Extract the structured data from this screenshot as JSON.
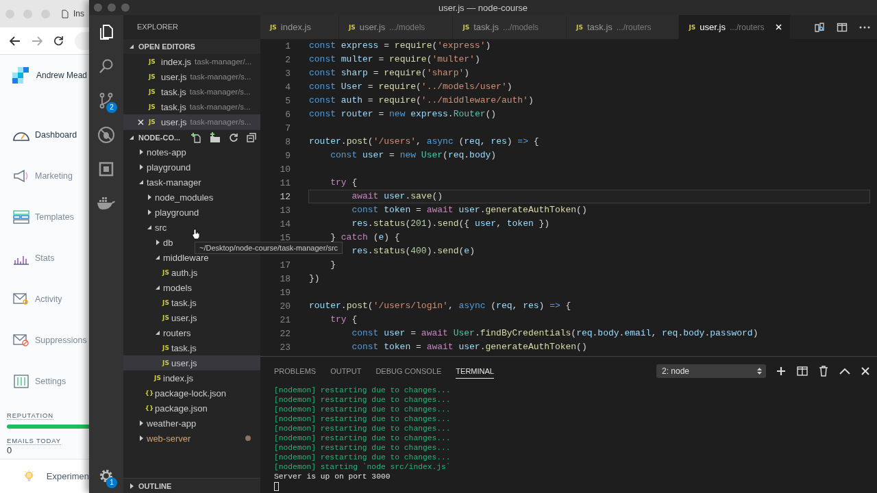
{
  "browser": {
    "tab_title": "Ins",
    "brand": "Andrew Mead",
    "nav": [
      {
        "label": "Dashboard",
        "selected": true
      },
      {
        "label": "Marketing",
        "selected": false
      },
      {
        "label": "Templates",
        "selected": false
      },
      {
        "label": "Stats",
        "selected": false
      },
      {
        "label": "Activity",
        "selected": false
      },
      {
        "label": "Suppressions",
        "selected": false
      },
      {
        "label": "Settings",
        "selected": false
      }
    ],
    "reputation": {
      "label": "REPUTATION",
      "level": 1
    },
    "emails_today": {
      "label": "EMAILS TODAY",
      "value": "0"
    },
    "footer": {
      "label": "Experimen"
    }
  },
  "window": {
    "title": "user.js — node-course"
  },
  "activity_bar": {
    "items": [
      {
        "kind": "files",
        "selected": true
      },
      {
        "kind": "search",
        "selected": false
      },
      {
        "kind": "source-control",
        "selected": false,
        "badge": "2"
      },
      {
        "kind": "debug",
        "selected": false
      },
      {
        "kind": "remote",
        "selected": false
      },
      {
        "kind": "docker",
        "selected": false
      }
    ],
    "settings": {
      "badge": "1"
    }
  },
  "explorer": {
    "title": "EXPLORER",
    "open_editors": {
      "title": "OPEN EDITORS",
      "expanded": true,
      "items": [
        {
          "icon": "JS",
          "name": "index.js",
          "path": "task-manager/...",
          "selected": false
        },
        {
          "icon": "JS",
          "name": "user.js",
          "path": "task-manager/s...",
          "selected": false
        },
        {
          "icon": "JS",
          "name": "task.js",
          "path": "task-manager/s...",
          "selected": false
        },
        {
          "icon": "JS",
          "name": "task.js",
          "path": "task-manager/s...",
          "selected": false
        },
        {
          "icon": "JS",
          "name": "user.js",
          "path": "task-manager/s...",
          "selected": true
        }
      ]
    },
    "project": {
      "title": "NODE-CO...",
      "expanded": true,
      "tree": [
        {
          "kind": "folder",
          "name": "notes-app",
          "expanded": false,
          "selected": false,
          "modified": false
        },
        {
          "kind": "folder",
          "name": "playground",
          "expanded": false,
          "selected": false,
          "modified": false
        },
        {
          "kind": "folder",
          "name": "task-manager",
          "expanded": true,
          "selected": false,
          "modified": false,
          "children": [
            {
              "kind": "folder",
              "name": "node_modules",
              "expanded": false,
              "selected": false,
              "modified": false
            },
            {
              "kind": "folder",
              "name": "playground",
              "expanded": false,
              "selected": false,
              "modified": false
            },
            {
              "kind": "folder",
              "name": "src",
              "expanded": true,
              "selected": false,
              "modified": false,
              "children": [
                {
                  "kind": "folder",
                  "name": "db",
                  "expanded": false,
                  "selected": false,
                  "modified": false
                },
                {
                  "kind": "folder",
                  "name": "middleware",
                  "expanded": true,
                  "selected": false,
                  "modified": false,
                  "children": [
                    {
                      "kind": "file",
                      "icon": "JS",
                      "name": "auth.js",
                      "selected": false,
                      "modified": false
                    }
                  ]
                },
                {
                  "kind": "folder",
                  "name": "models",
                  "expanded": true,
                  "selected": false,
                  "modified": false,
                  "children": [
                    {
                      "kind": "file",
                      "icon": "JS",
                      "name": "task.js",
                      "selected": false,
                      "modified": false
                    },
                    {
                      "kind": "file",
                      "icon": "JS",
                      "name": "user.js",
                      "selected": false,
                      "modified": false
                    }
                  ]
                },
                {
                  "kind": "folder",
                  "name": "routers",
                  "expanded": true,
                  "selected": false,
                  "modified": false,
                  "children": [
                    {
                      "kind": "file",
                      "icon": "JS",
                      "name": "task.js",
                      "selected": false,
                      "modified": false
                    },
                    {
                      "kind": "file",
                      "icon": "JS",
                      "name": "user.js",
                      "selected": true,
                      "modified": false
                    }
                  ]
                },
                {
                  "kind": "file",
                  "icon": "JS",
                  "name": "index.js",
                  "selected": false,
                  "modified": false
                }
              ]
            },
            {
              "kind": "file",
              "icon": "{}",
              "name": "package-lock.json",
              "selected": false,
              "modified": false
            },
            {
              "kind": "file",
              "icon": "{}",
              "name": "package.json",
              "selected": false,
              "modified": false
            }
          ]
        },
        {
          "kind": "folder",
          "name": "weather-app",
          "expanded": false,
          "selected": false,
          "modified": false
        },
        {
          "kind": "folder",
          "name": "web-server",
          "expanded": false,
          "selected": false,
          "modified": true
        }
      ]
    },
    "outline": {
      "title": "OUTLINE",
      "expanded": false
    }
  },
  "tooltip": "~/Desktop/node-course/task-manager/src",
  "tabs": [
    {
      "icon": "JS",
      "name": "index.js",
      "selected": false
    },
    {
      "icon": "JS",
      "name": "user.js",
      "path": ".../models",
      "selected": false
    },
    {
      "icon": "JS",
      "name": "task.js",
      "path": ".../models",
      "selected": false
    },
    {
      "icon": "JS",
      "name": "task.js",
      "path": ".../routers",
      "selected": false
    },
    {
      "icon": "JS",
      "name": "user.js",
      "path": ".../routers",
      "selected": true
    }
  ],
  "editor": {
    "lines": [
      {
        "number": "1",
        "current": false,
        "tokens": [
          {
            "kind": "keyword",
            "text": "const "
          },
          {
            "kind": "variable",
            "text": "express"
          },
          {
            "kind": "plain",
            "text": " = "
          },
          {
            "kind": "function",
            "text": "require"
          },
          {
            "kind": "plain",
            "text": "("
          },
          {
            "kind": "string",
            "text": "'express'"
          },
          {
            "kind": "plain",
            "text": ")"
          }
        ]
      },
      {
        "number": "2",
        "current": false,
        "tokens": [
          {
            "kind": "keyword",
            "text": "const "
          },
          {
            "kind": "variable",
            "text": "multer"
          },
          {
            "kind": "plain",
            "text": " = "
          },
          {
            "kind": "function",
            "text": "require"
          },
          {
            "kind": "plain",
            "text": "("
          },
          {
            "kind": "string",
            "text": "'multer'"
          },
          {
            "kind": "plain",
            "text": ")"
          }
        ]
      },
      {
        "number": "3",
        "current": false,
        "tokens": [
          {
            "kind": "keyword",
            "text": "const "
          },
          {
            "kind": "variable",
            "text": "sharp"
          },
          {
            "kind": "plain",
            "text": " = "
          },
          {
            "kind": "function",
            "text": "require"
          },
          {
            "kind": "plain",
            "text": "("
          },
          {
            "kind": "string",
            "text": "'sharp'"
          },
          {
            "kind": "plain",
            "text": ")"
          }
        ]
      },
      {
        "number": "4",
        "current": false,
        "tokens": [
          {
            "kind": "keyword",
            "text": "const "
          },
          {
            "kind": "variable",
            "text": "User"
          },
          {
            "kind": "plain",
            "text": " = "
          },
          {
            "kind": "function",
            "text": "require"
          },
          {
            "kind": "plain",
            "text": "("
          },
          {
            "kind": "string",
            "text": "'../models/user'"
          },
          {
            "kind": "plain",
            "text": ")"
          }
        ]
      },
      {
        "number": "5",
        "current": false,
        "tokens": [
          {
            "kind": "keyword",
            "text": "const "
          },
          {
            "kind": "variable",
            "text": "auth"
          },
          {
            "kind": "plain",
            "text": " = "
          },
          {
            "kind": "function",
            "text": "require"
          },
          {
            "kind": "plain",
            "text": "("
          },
          {
            "kind": "string",
            "text": "'../middleware/auth'"
          },
          {
            "kind": "plain",
            "text": ")"
          }
        ]
      },
      {
        "number": "6",
        "current": false,
        "tokens": [
          {
            "kind": "keyword",
            "text": "const "
          },
          {
            "kind": "variable",
            "text": "router"
          },
          {
            "kind": "plain",
            "text": " = "
          },
          {
            "kind": "keyword",
            "text": "new "
          },
          {
            "kind": "variable",
            "text": "express"
          },
          {
            "kind": "plain",
            "text": "."
          },
          {
            "kind": "type",
            "text": "Router"
          },
          {
            "kind": "plain",
            "text": "()"
          }
        ]
      },
      {
        "number": "7",
        "current": false
      },
      {
        "number": "8",
        "current": false,
        "tokens": [
          {
            "kind": "variable",
            "text": "router"
          },
          {
            "kind": "plain",
            "text": "."
          },
          {
            "kind": "function",
            "text": "post"
          },
          {
            "kind": "plain",
            "text": "("
          },
          {
            "kind": "string",
            "text": "'/users'"
          },
          {
            "kind": "plain",
            "text": ", "
          },
          {
            "kind": "keyword",
            "text": "async"
          },
          {
            "kind": "plain",
            "text": " ("
          },
          {
            "kind": "variable",
            "text": "req"
          },
          {
            "kind": "plain",
            "text": ", "
          },
          {
            "kind": "variable",
            "text": "res"
          },
          {
            "kind": "plain",
            "text": ") "
          },
          {
            "kind": "keyword",
            "text": "=>"
          },
          {
            "kind": "plain",
            "text": " {"
          }
        ]
      },
      {
        "number": "9",
        "current": false,
        "tokens": [
          {
            "kind": "keyword",
            "text": "    const "
          },
          {
            "kind": "variable",
            "text": "user"
          },
          {
            "kind": "plain",
            "text": " = "
          },
          {
            "kind": "keyword",
            "text": "new "
          },
          {
            "kind": "type",
            "text": "User"
          },
          {
            "kind": "plain",
            "text": "("
          },
          {
            "kind": "variable",
            "text": "req"
          },
          {
            "kind": "plain",
            "text": "."
          },
          {
            "kind": "variable",
            "text": "body"
          },
          {
            "kind": "plain",
            "text": ")"
          }
        ]
      },
      {
        "number": "10",
        "current": false
      },
      {
        "number": "11",
        "current": false,
        "tokens": [
          {
            "kind": "control",
            "text": "    try"
          },
          {
            "kind": "plain",
            "text": " {"
          }
        ]
      },
      {
        "number": "12",
        "current": true,
        "tokens": [
          {
            "kind": "control",
            "text": "        await "
          },
          {
            "kind": "variable",
            "text": "user"
          },
          {
            "kind": "plain",
            "text": "."
          },
          {
            "kind": "function",
            "text": "save"
          },
          {
            "kind": "plain",
            "text": "()"
          }
        ]
      },
      {
        "number": "13",
        "current": false,
        "tokens": [
          {
            "kind": "keyword",
            "text": "        const "
          },
          {
            "kind": "variable",
            "text": "token"
          },
          {
            "kind": "plain",
            "text": " = "
          },
          {
            "kind": "control",
            "text": "await "
          },
          {
            "kind": "variable",
            "text": "user"
          },
          {
            "kind": "plain",
            "text": "."
          },
          {
            "kind": "function",
            "text": "generateAuthToken"
          },
          {
            "kind": "plain",
            "text": "()"
          }
        ]
      },
      {
        "number": "14",
        "current": false,
        "tokens": [
          {
            "kind": "variable",
            "text": "        res"
          },
          {
            "kind": "plain",
            "text": "."
          },
          {
            "kind": "function",
            "text": "status"
          },
          {
            "kind": "plain",
            "text": "("
          },
          {
            "kind": "number",
            "text": "201"
          },
          {
            "kind": "plain",
            "text": ")."
          },
          {
            "kind": "function",
            "text": "send"
          },
          {
            "kind": "plain",
            "text": "({ "
          },
          {
            "kind": "variable",
            "text": "user"
          },
          {
            "kind": "plain",
            "text": ", "
          },
          {
            "kind": "variable",
            "text": "token"
          },
          {
            "kind": "plain",
            "text": " })"
          }
        ]
      },
      {
        "number": "15",
        "current": false,
        "tokens": [
          {
            "kind": "plain",
            "text": "    } "
          },
          {
            "kind": "control",
            "text": "catch"
          },
          {
            "kind": "plain",
            "text": " ("
          },
          {
            "kind": "variable",
            "text": "e"
          },
          {
            "kind": "plain",
            "text": ") {"
          }
        ]
      },
      {
        "current": false,
        "tokens": [
          {
            "kind": "variable",
            "text": "        res"
          },
          {
            "kind": "plain",
            "text": "."
          },
          {
            "kind": "function",
            "text": "status"
          },
          {
            "kind": "plain",
            "text": "("
          },
          {
            "kind": "number",
            "text": "400"
          },
          {
            "kind": "plain",
            "text": ")."
          },
          {
            "kind": "function",
            "text": "send"
          },
          {
            "kind": "plain",
            "text": "("
          },
          {
            "kind": "variable",
            "text": "e"
          },
          {
            "kind": "plain",
            "text": ")"
          }
        ]
      },
      {
        "number": "17",
        "current": false,
        "tokens": [
          {
            "kind": "plain",
            "text": "    }"
          }
        ]
      },
      {
        "number": "18",
        "current": false,
        "tokens": [
          {
            "kind": "plain",
            "text": "})"
          }
        ]
      },
      {
        "number": "19",
        "current": false
      },
      {
        "number": "20",
        "current": false,
        "tokens": [
          {
            "kind": "variable",
            "text": "router"
          },
          {
            "kind": "plain",
            "text": "."
          },
          {
            "kind": "function",
            "text": "post"
          },
          {
            "kind": "plain",
            "text": "("
          },
          {
            "kind": "string",
            "text": "'/users/login'"
          },
          {
            "kind": "plain",
            "text": ", "
          },
          {
            "kind": "keyword",
            "text": "async"
          },
          {
            "kind": "plain",
            "text": " ("
          },
          {
            "kind": "variable",
            "text": "req"
          },
          {
            "kind": "plain",
            "text": ", "
          },
          {
            "kind": "variable",
            "text": "res"
          },
          {
            "kind": "plain",
            "text": ") "
          },
          {
            "kind": "keyword",
            "text": "=>"
          },
          {
            "kind": "plain",
            "text": " {"
          }
        ]
      },
      {
        "number": "21",
        "current": false,
        "tokens": [
          {
            "kind": "control",
            "text": "    try"
          },
          {
            "kind": "plain",
            "text": " {"
          }
        ]
      },
      {
        "number": "22",
        "current": false,
        "tokens": [
          {
            "kind": "keyword",
            "text": "        const "
          },
          {
            "kind": "variable",
            "text": "user"
          },
          {
            "kind": "plain",
            "text": " = "
          },
          {
            "kind": "control",
            "text": "await "
          },
          {
            "kind": "type",
            "text": "User"
          },
          {
            "kind": "plain",
            "text": "."
          },
          {
            "kind": "function",
            "text": "findByCredentials"
          },
          {
            "kind": "plain",
            "text": "("
          },
          {
            "kind": "variable",
            "text": "req"
          },
          {
            "kind": "plain",
            "text": "."
          },
          {
            "kind": "variable",
            "text": "body"
          },
          {
            "kind": "plain",
            "text": "."
          },
          {
            "kind": "variable",
            "text": "email"
          },
          {
            "kind": "plain",
            "text": ", "
          },
          {
            "kind": "variable",
            "text": "req"
          },
          {
            "kind": "plain",
            "text": "."
          },
          {
            "kind": "variable",
            "text": "body"
          },
          {
            "kind": "plain",
            "text": "."
          },
          {
            "kind": "variable",
            "text": "password"
          },
          {
            "kind": "plain",
            "text": ")"
          }
        ]
      },
      {
        "number": "23",
        "current": false,
        "tokens": [
          {
            "kind": "keyword",
            "text": "        const "
          },
          {
            "kind": "variable",
            "text": "token"
          },
          {
            "kind": "plain",
            "text": " = "
          },
          {
            "kind": "control",
            "text": "await "
          },
          {
            "kind": "variable",
            "text": "user"
          },
          {
            "kind": "plain",
            "text": "."
          },
          {
            "kind": "function",
            "text": "generateAuthToken"
          },
          {
            "kind": "plain",
            "text": "()"
          }
        ]
      }
    ]
  },
  "panel": {
    "tabs": [
      {
        "label": "PROBLEMS",
        "selected": false
      },
      {
        "label": "OUTPUT",
        "selected": false
      },
      {
        "label": "DEBUG CONSOLE",
        "selected": false
      },
      {
        "label": "TERMINAL",
        "selected": true
      }
    ],
    "terminal_select": "2: node",
    "terminal": [
      {
        "kind": "nodemon",
        "text": "[nodemon] restarting due to changes..."
      },
      {
        "kind": "nodemon",
        "text": "[nodemon] restarting due to changes..."
      },
      {
        "kind": "nodemon",
        "text": "[nodemon] restarting due to changes..."
      },
      {
        "kind": "nodemon",
        "text": "[nodemon] restarting due to changes..."
      },
      {
        "kind": "nodemon",
        "text": "[nodemon] restarting due to changes..."
      },
      {
        "kind": "nodemon",
        "text": "[nodemon] restarting due to changes..."
      },
      {
        "kind": "nodemon",
        "text": "[nodemon] restarting due to changes..."
      },
      {
        "kind": "nodemon",
        "text": "[nodemon] restarting due to changes..."
      },
      {
        "kind": "nodemon",
        "text": "[nodemon] starting `node src/index.js`"
      },
      {
        "kind": "output",
        "text": "Server is up on port 3000"
      }
    ]
  }
}
